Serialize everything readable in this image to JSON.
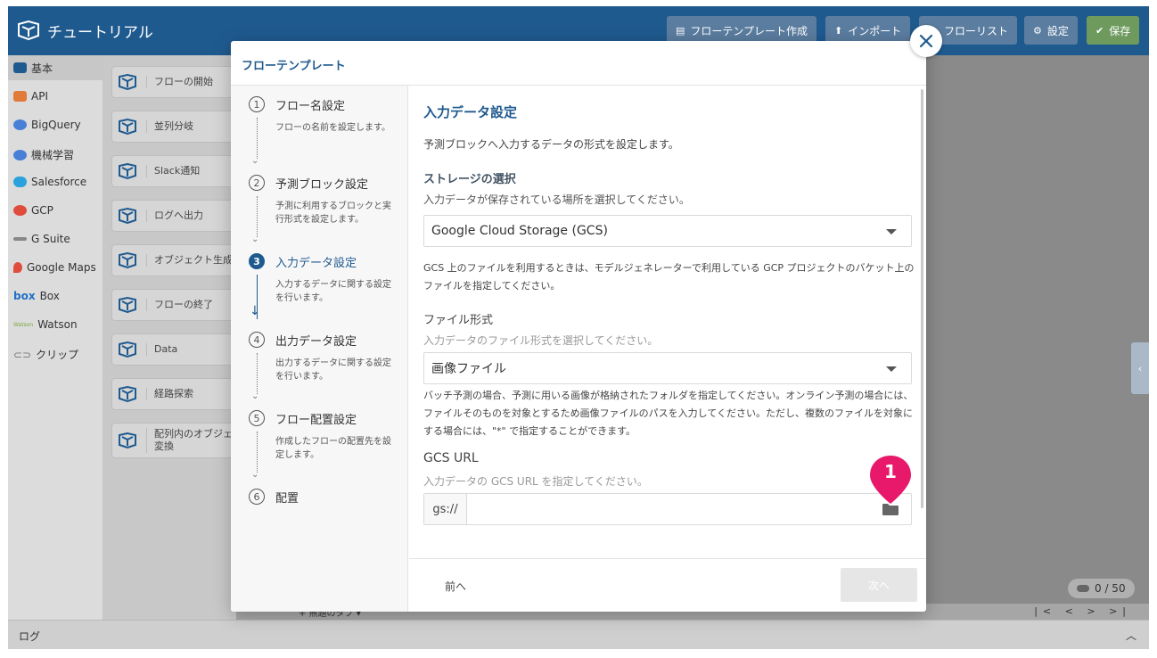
{
  "app": {
    "title": "チュートリアル",
    "header_buttons": {
      "flow_template": "フローテンプレート作成",
      "import": "インポート",
      "flow_list": "フローリスト",
      "settings": "設定",
      "save": "保存"
    }
  },
  "palette": [
    {
      "label": "基本",
      "color": "#1f5a8f"
    },
    {
      "label": "API",
      "color": "#e07b39"
    },
    {
      "label": "BigQuery",
      "color": "#4a7fd6"
    },
    {
      "label": "機械学習",
      "color": "#4a7fd6"
    },
    {
      "label": "Salesforce",
      "color": "#2aa3dc"
    },
    {
      "label": "GCP",
      "color": "#e04c3c"
    },
    {
      "label": "G Suite",
      "color": "#888888"
    },
    {
      "label": "Google Maps",
      "color": "#e04c3c"
    },
    {
      "label": "Box",
      "color": "#1f6fc9"
    },
    {
      "label": "Watson",
      "color": "#7aa83a"
    },
    {
      "label": "クリップ",
      "color": "#777777"
    }
  ],
  "blocks": [
    {
      "label": "フローの開始"
    },
    {
      "label": "並列分岐"
    },
    {
      "label": "Slack通知"
    },
    {
      "label": "ログへ出力"
    },
    {
      "label": "オブジェクト生成"
    },
    {
      "label": "フローの終了"
    },
    {
      "label": "Data"
    },
    {
      "label": "経路探索"
    },
    {
      "label": "配列内のオブジェ\n変換"
    }
  ],
  "canvas": {
    "counter": "0 / 50",
    "pager": "|< < > >|",
    "tab_peek": "+   無題のタブ ▾"
  },
  "log": {
    "label": "ログ"
  },
  "modal": {
    "title": "フローテンプレート",
    "steps": [
      {
        "num": "1",
        "title": "フロー名設定",
        "desc": "フローの名前を設定します。"
      },
      {
        "num": "2",
        "title": "予測ブロック設定",
        "desc": "予測に利用するブロックと実行形式を設定します。"
      },
      {
        "num": "3",
        "title": "入力データ設定",
        "desc": "入力するデータに関する設定を行います。"
      },
      {
        "num": "4",
        "title": "出力データ設定",
        "desc": "出力するデータに関する設定を行います。"
      },
      {
        "num": "5",
        "title": "フロー配置設定",
        "desc": "作成したフローの配置先を設定します。"
      },
      {
        "num": "6",
        "title": "配置",
        "desc": ""
      }
    ],
    "active_step": 3,
    "content": {
      "title": "入力データ設定",
      "description": "予測ブロックへ入力するデータの形式を設定します。",
      "storage": {
        "heading": "ストレージの選択",
        "hint": "入力データが保存されている場所を選択してください。",
        "selected": "Google Cloud Storage (GCS)",
        "note": "GCS 上のファイルを利用するときは、モデルジェネレーターで利用している GCP プロジェクトのバケット上のファイルを指定してください。"
      },
      "file_format": {
        "label": "ファイル形式",
        "hint": "入力データのファイル形式を選択してください。",
        "selected": "画像ファイル",
        "note": "バッチ予測の場合、予測に用いる画像が格納されたフォルダを指定してください。オンライン予測の場合には、ファイルそのものを対象とするため画像ファイルのパスを入力してください。ただし、複数のファイルを対象にする場合には、\"*\" で指定することができます。"
      },
      "gcs_url": {
        "label": "GCS URL",
        "hint": "入力データの GCS URL を指定してください。",
        "prefix": "gs://",
        "value": "",
        "placeholder": ""
      },
      "callout": "1"
    },
    "footer": {
      "prev": "前へ",
      "next": "次へ"
    }
  }
}
